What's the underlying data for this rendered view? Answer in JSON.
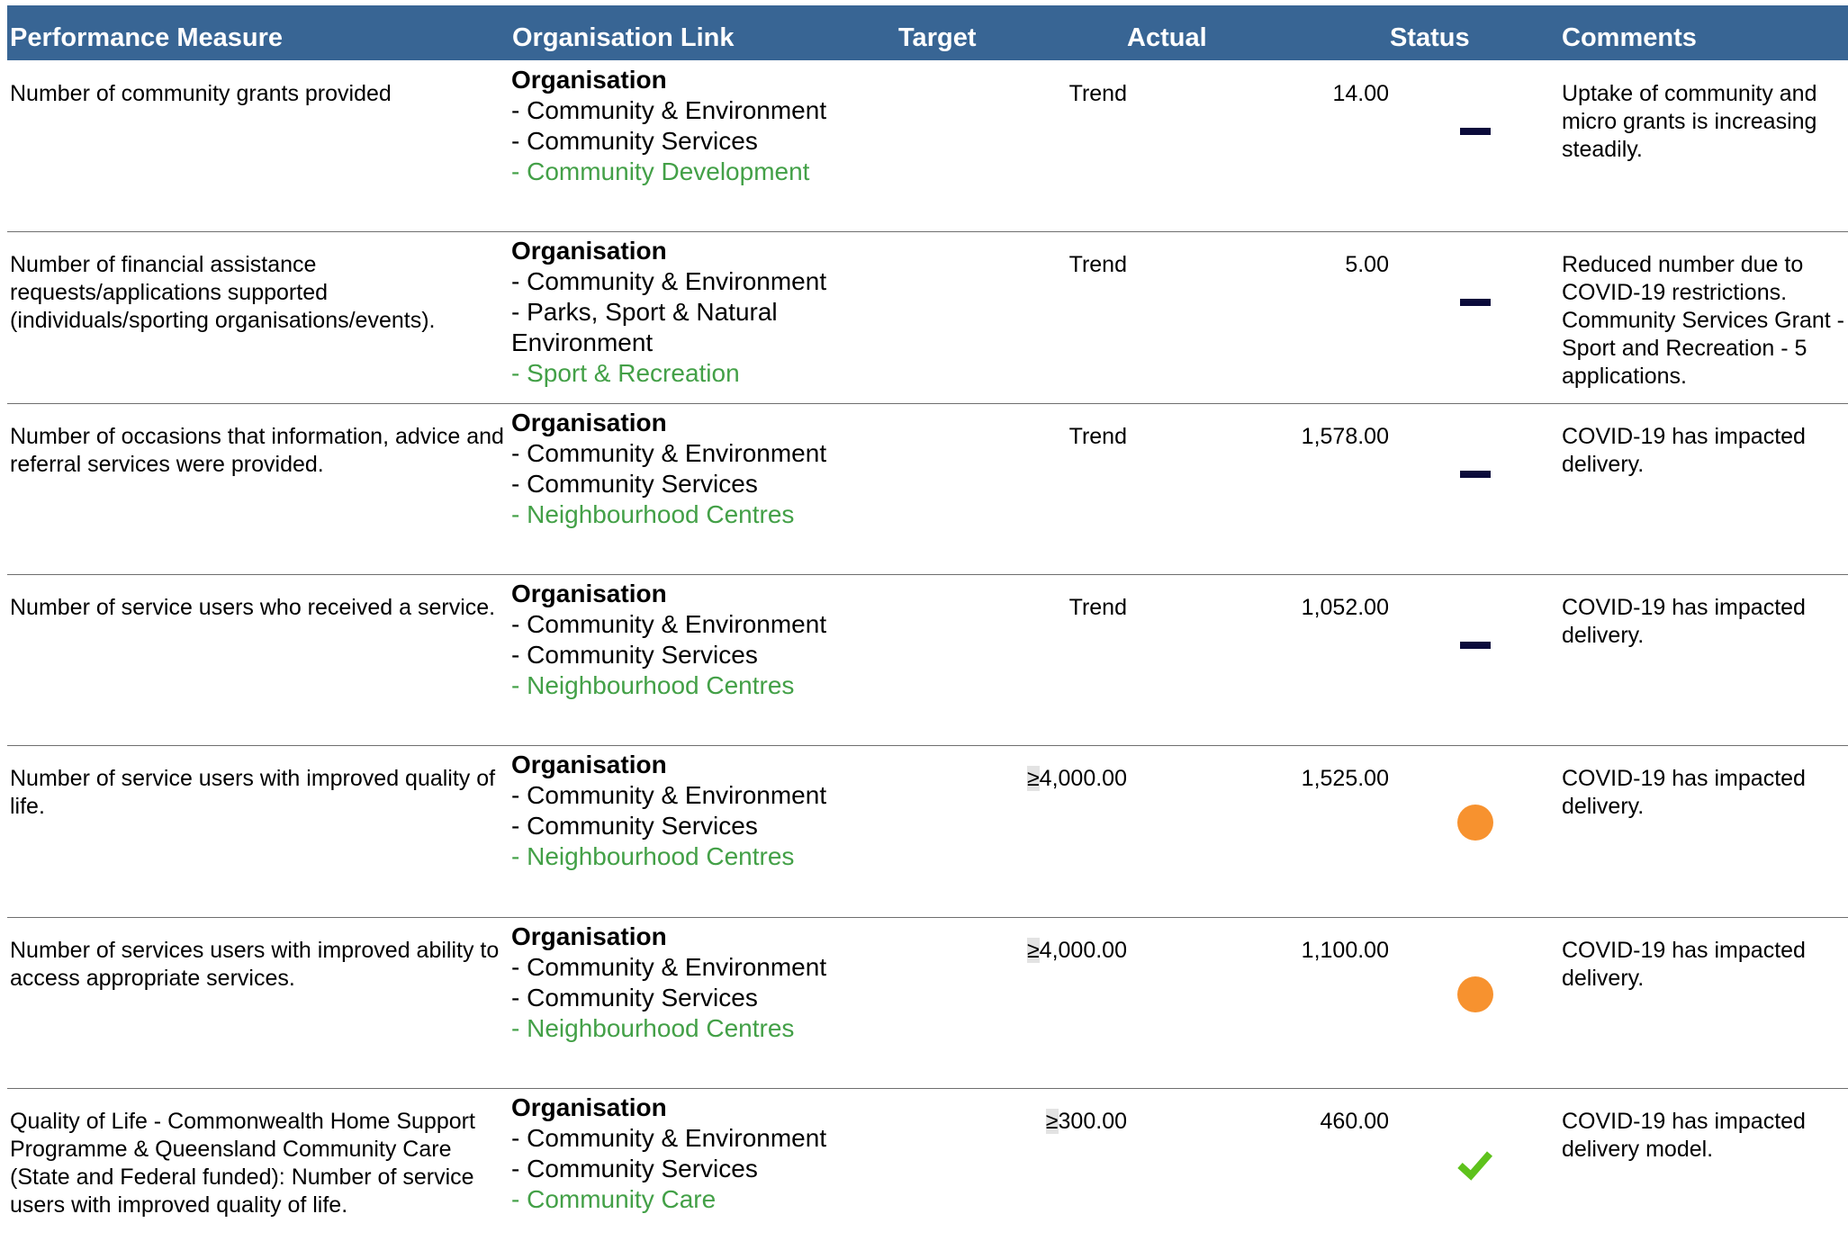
{
  "table": {
    "headers": {
      "measure": "Performance Measure",
      "org": "Organisation Link",
      "target": "Target",
      "actual": "Actual",
      "status": "Status",
      "comments": "Comments"
    },
    "rows": [
      {
        "measure": "Number of community grants provided",
        "org_head": "Organisation",
        "org_lines": [
          "- Community & Environment",
          "- Community Services"
        ],
        "org_link": "- Community Development",
        "target": "Trend",
        "target_prefix": "",
        "actual": "14.00",
        "status": "dash-icon",
        "comment": "Uptake of community and micro grants is increasing steadily."
      },
      {
        "measure": "Number of financial assistance requests/applications supported (individuals/sporting organisations/events).",
        "org_head": "Organisation",
        "org_lines": [
          "- Community & Environment",
          "- Parks, Sport & Natural Environment"
        ],
        "org_link": "- Sport & Recreation",
        "target": "Trend",
        "target_prefix": "",
        "actual": "5.00",
        "status": "dash-icon",
        "comment": "Reduced number due to COVID-19 restrictions. Community Services Grant - Sport and Recreation - 5 applications."
      },
      {
        "measure": "Number of occasions that information, advice and referral services were provided.",
        "org_head": "Organisation",
        "org_lines": [
          "- Community & Environment",
          "- Community Services"
        ],
        "org_link": "- Neighbourhood Centres",
        "target": "Trend",
        "target_prefix": "",
        "actual": "1,578.00",
        "status": "dash-icon",
        "comment": "COVID-19 has impacted delivery."
      },
      {
        "measure": "Number of service users who received a service.",
        "org_head": "Organisation",
        "org_lines": [
          "- Community & Environment",
          "- Community Services"
        ],
        "org_link": "- Neighbourhood Centres",
        "target": "Trend",
        "target_prefix": "",
        "actual": "1,052.00",
        "status": "dash-icon",
        "comment": "COVID-19 has impacted delivery."
      },
      {
        "measure": "Number of service users with improved quality of life.",
        "org_head": "Organisation",
        "org_lines": [
          "- Community & Environment",
          "- Community Services"
        ],
        "org_link": "- Neighbourhood Centres",
        "target": "4,000.00",
        "target_prefix": "≥",
        "actual": "1,525.00",
        "status": "orange-circle-icon",
        "comment": "COVID-19 has impacted delivery."
      },
      {
        "measure": "Number of services users with improved ability to access appropriate services.",
        "org_head": "Organisation",
        "org_lines": [
          "- Community & Environment",
          "- Community Services"
        ],
        "org_link": "- Neighbourhood Centres",
        "target": "4,000.00",
        "target_prefix": "≥",
        "actual": "1,100.00",
        "status": "orange-circle-icon",
        "comment": "COVID-19 has impacted delivery."
      },
      {
        "measure": "Quality of Life - Commonwealth Home Support Programme & Queensland Community Care (State and Federal funded): Number of service users with improved quality of life.",
        "org_head": "Organisation",
        "org_lines": [
          "- Community & Environment",
          "- Community Services"
        ],
        "org_link": "- Community Care",
        "target": "300.00",
        "target_prefix": "≥",
        "actual": "460.00",
        "status": "green-check-icon",
        "comment": "COVID-19 has impacted delivery model."
      }
    ]
  },
  "colors": {
    "header_bg": "#386594",
    "link_green": "#43a047",
    "dash": "#0b0b3b",
    "orange": "#f7922f",
    "check_green": "#5ec21c"
  }
}
